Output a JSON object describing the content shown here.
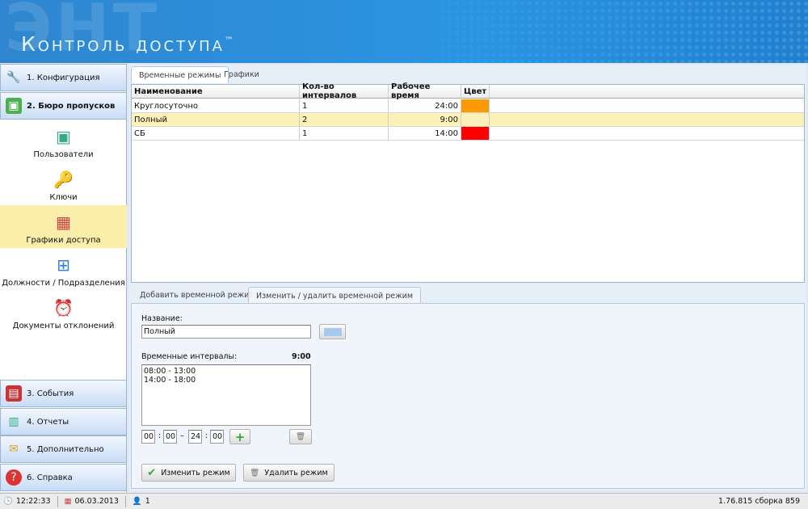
{
  "header": {
    "watermark": "ЭНТ",
    "title": "Контроль доступа",
    "tm": "™"
  },
  "sidebar": {
    "top": [
      {
        "label": "1. Конфигурация"
      },
      {
        "label": "2. Бюро пропусков"
      }
    ],
    "sub": [
      {
        "label": "Пользователи"
      },
      {
        "label": "Ключи"
      },
      {
        "label": "Графики доступа"
      },
      {
        "label": "Должности / Подразделения"
      },
      {
        "label": "Документы отклонений"
      }
    ],
    "bottom": [
      {
        "label": "3. События"
      },
      {
        "label": "4. Отчеты"
      },
      {
        "label": "5. Дополнительно"
      },
      {
        "label": "6. Справка"
      }
    ]
  },
  "tabs": [
    "Временные режимы",
    "Графики"
  ],
  "table": {
    "headers": [
      "Наименование",
      "Кол-во интервалов",
      "Рабочее время",
      "Цвет"
    ],
    "rows": [
      {
        "name": "Круглосуточно",
        "count": "1",
        "time": "24:00",
        "color": "#ff9900"
      },
      {
        "name": "Полный",
        "count": "2",
        "time": "9:00",
        "color": "#fbf1b8"
      },
      {
        "name": "СБ",
        "count": "1",
        "time": "14:00",
        "color": "#ff0000"
      }
    ]
  },
  "form_tabs": [
    "Добавить временной режим",
    "Изменить / удалить временной режим"
  ],
  "form": {
    "name_label": "Название:",
    "name_value": "Полный",
    "color_value": "#a9c8ee",
    "intervals_label": "Временные интервалы:",
    "total": "9:00",
    "intervals": [
      "08:00 - 13:00",
      "14:00 - 18:00"
    ],
    "from_h": "00",
    "from_m": "00",
    "to_h": "24",
    "to_m": "00",
    "colon": ":",
    "dash": "–",
    "change_btn": "Изменить режим",
    "delete_btn": "Удалить режим"
  },
  "status": {
    "time": "12:22:33",
    "date": "06.03.2013",
    "users": "1",
    "version": "1.76.815 сборка 859"
  }
}
